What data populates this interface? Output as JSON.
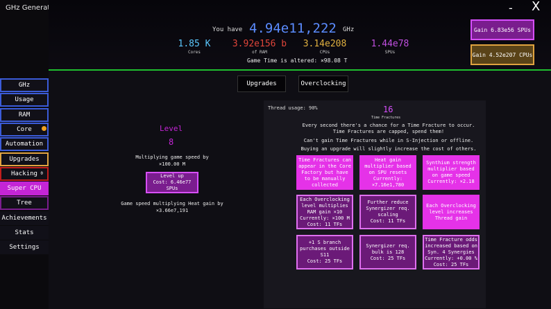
{
  "app": {
    "title": "GHz Generator",
    "minimize": "-",
    "close": "X"
  },
  "header": {
    "you_have": "You have",
    "ghz_value": "4.94e11,222",
    "ghz_unit": "GHz",
    "stats": [
      {
        "value": "1.85 K",
        "label": "Cores",
        "color": "#5bc8ff"
      },
      {
        "value": "3.92e156 b",
        "label": "of RAM",
        "color": "#e0453a"
      },
      {
        "value": "3.14e208",
        "label": "CPUs",
        "color": "#e0b040"
      },
      {
        "value": "1.44e78",
        "label": "SPUs",
        "color": "#c04fe0"
      }
    ],
    "game_time": "Game Time is altered: ×98.08 T",
    "gain_spu": "Gain 6.83e56 SPUs",
    "gain_cpu": "Gain 4.52e207 CPUs"
  },
  "sidebar": [
    {
      "label": "GHz"
    },
    {
      "label": "Usage"
    },
    {
      "label": "RAM"
    },
    {
      "label": "Core"
    },
    {
      "label": "Automation"
    },
    {
      "label": "Upgrades"
    },
    {
      "label": "Hacking"
    },
    {
      "label": "Super CPU"
    },
    {
      "label": "Tree"
    },
    {
      "label": "Achievements"
    },
    {
      "label": "Stats"
    },
    {
      "label": "Settings"
    }
  ],
  "hacking_sup": "0",
  "tabs": {
    "upgrades": "Upgrades",
    "overclocking": "Overclocking"
  },
  "overclock": {
    "level_title": "Level",
    "level_num": "8",
    "mult_line1": "Multiplying game speed by",
    "mult_line2": "×100.00 M",
    "levelup_l1": "Level up",
    "levelup_l2": "Cost: 6.46e77",
    "levelup_l3": "SPUs",
    "heat_line1": "Game speed multiplying Heat gain by",
    "heat_line2": "×3.66e7,191"
  },
  "fracture": {
    "thread_usage": "Thread usage: 90%",
    "count": "16",
    "label": "Time Fractures",
    "info1": "Every second there's a chance for a Time Fracture to occur.",
    "info2": "Time Fractures are capped, spend them!",
    "info3": "Can't gain Time Fractures while in S-Injection or offline.",
    "info4": "Buying an upgrade will slightly increase the cost of others."
  },
  "upgrades": [
    {
      "lines": [
        "Time Fractures can",
        "appear in the Core",
        "Factory but have",
        "to be manually",
        "collected"
      ]
    },
    {
      "lines": [
        "Heat gain",
        "multiplier based",
        "on SPU resets",
        "Currently:",
        "×7.16e1,780"
      ]
    },
    {
      "lines": [
        "Synthium strength",
        "multiplier based",
        "on game speed",
        "Currently: ×2.18"
      ]
    },
    {
      "lines": [
        "Each Overclocking",
        "level multiplies",
        "RAM gain ×10",
        "Currently: ×100 M",
        "Cost: 11 TFs"
      ]
    },
    {
      "lines": [
        "Further reduce",
        "Synergizer req.",
        "scaling",
        "Cost: 11 TFs"
      ]
    },
    {
      "lines": [
        "Each Overclocking",
        "level increases",
        "Thread gain"
      ]
    },
    {
      "lines": [
        "+1 S branch",
        "purchases outside",
        "S11",
        "Cost: 25 TFs"
      ]
    },
    {
      "lines": [
        "Synergizer req.",
        "bulk is 128",
        "Cost: 25 TFs"
      ]
    },
    {
      "lines": [
        "Time Fracture odds",
        "increased based on",
        "Syn. 4 Synergies",
        "Currently: +0.00 %",
        "Cost: 25 TFs"
      ]
    }
  ]
}
